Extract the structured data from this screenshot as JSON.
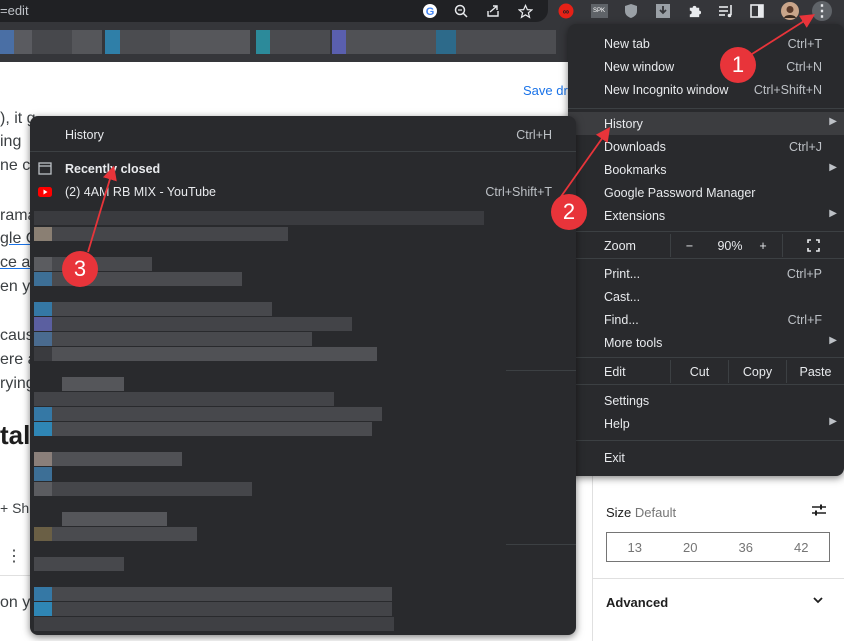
{
  "toolbar": {
    "url_fragment": "=edit",
    "icons": [
      "google-icon",
      "zoom-icon",
      "share-icon",
      "bookmark-star-icon",
      "extension-red-icon",
      "extension-spk-icon",
      "shield-icon",
      "download-icon",
      "puzzle-icon",
      "media-queue-icon",
      "side-panel-icon",
      "profile-avatar",
      "kebab-menu-icon"
    ],
    "spk_label": "SPK",
    "kebab_glyph": "⋮"
  },
  "page": {
    "save_draft": "Save dra",
    "fragments": [
      "), it g",
      "ing",
      "ne c",
      "rama",
      "gle C",
      "ce a",
      "en yo",
      "caus",
      "ere a",
      "rying",
      "tal",
      "+ Sh",
      "⋮",
      "on yo"
    ],
    "size_label": "Size",
    "size_value": "Default",
    "size_options": [
      "13",
      "20",
      "36",
      "42"
    ],
    "advanced": "Advanced"
  },
  "history_menu": {
    "history": "History",
    "history_shortcut": "Ctrl+H",
    "recently_closed": "Recently closed",
    "item_youtube": "(2) 4AM RB MIX - YouTube",
    "item_youtube_shortcut": "Ctrl+Shift+T"
  },
  "chrome_menu": {
    "new_tab": "New tab",
    "new_tab_shortcut": "Ctrl+T",
    "new_window": "New window",
    "new_window_shortcut": "Ctrl+N",
    "new_incognito": "New Incognito window",
    "new_incognito_shortcut": "Ctrl+Shift+N",
    "history": "History",
    "downloads": "Downloads",
    "downloads_shortcut": "Ctrl+J",
    "bookmarks": "Bookmarks",
    "password_manager": "Google Password Manager",
    "extensions": "Extensions",
    "zoom": "Zoom",
    "zoom_minus": "−",
    "zoom_value": "90%",
    "zoom_plus": "+",
    "print": "Print...",
    "print_shortcut": "Ctrl+P",
    "cast": "Cast...",
    "find": "Find...",
    "find_shortcut": "Ctrl+F",
    "more_tools": "More tools",
    "edit": "Edit",
    "cut": "Cut",
    "copy": "Copy",
    "paste": "Paste",
    "settings": "Settings",
    "help": "Help",
    "exit": "Exit"
  },
  "callouts": [
    "1",
    "2",
    "3"
  ],
  "colors": {
    "menu_bg": "#292a2d",
    "callout": "#e8343a",
    "accent_link": "#1a73e8"
  }
}
